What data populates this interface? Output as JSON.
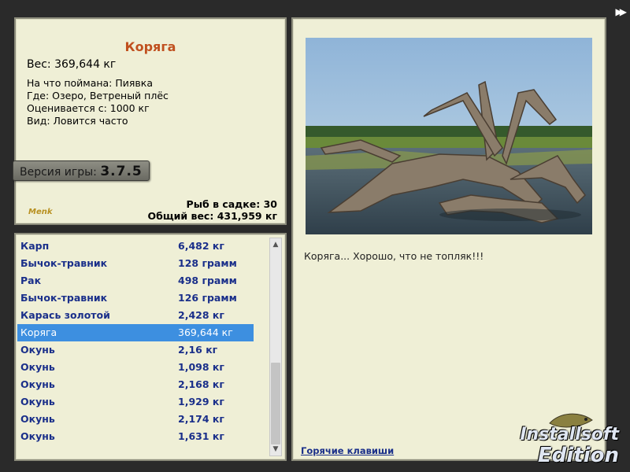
{
  "info": {
    "title": "Коряга",
    "weight": "Вес: 369,644 кг",
    "details": [
      "На что поймана: Пиявка",
      "Где: Озеро, Ветреный плёс",
      "Оценивается с: 1000 кг",
      "Вид: Ловится часто"
    ],
    "version_label": "Версия игры:",
    "version_value": "3.7.5",
    "logo_text": "Menk",
    "fish_count": "Рыб в садке: 30",
    "total_weight": "Общий вес: 431,959 кг"
  },
  "catch_list": [
    {
      "name": "Карп",
      "weight": "6,482 кг"
    },
    {
      "name": "Бычок-травник",
      "weight": "128 грамм"
    },
    {
      "name": "Рак",
      "weight": "498 грамм"
    },
    {
      "name": "Бычок-травник",
      "weight": "126 грамм"
    },
    {
      "name": "Карась золотой",
      "weight": "2,428 кг"
    },
    {
      "name": "Коряга",
      "weight": "369,644 кг",
      "selected": true
    },
    {
      "name": "Окунь",
      "weight": "2,16 кг"
    },
    {
      "name": "Окунь",
      "weight": "1,098 кг"
    },
    {
      "name": "Окунь",
      "weight": "2,168 кг"
    },
    {
      "name": "Окунь",
      "weight": "1,929 кг"
    },
    {
      "name": "Окунь",
      "weight": "2,174 кг"
    },
    {
      "name": "Окунь",
      "weight": "1,631 кг"
    }
  ],
  "detail": {
    "caption": "Коряга... Хорошо, что не топляк!!!",
    "hotkeys": "Горячие клавиши"
  },
  "brand": {
    "line1": "Installsoft",
    "line2": "Edition"
  },
  "colors": {
    "selected_row": "#3d8fe0",
    "list_text": "#1a2f8a",
    "title": "#c0501f",
    "panel_bg": "#efefd6"
  }
}
